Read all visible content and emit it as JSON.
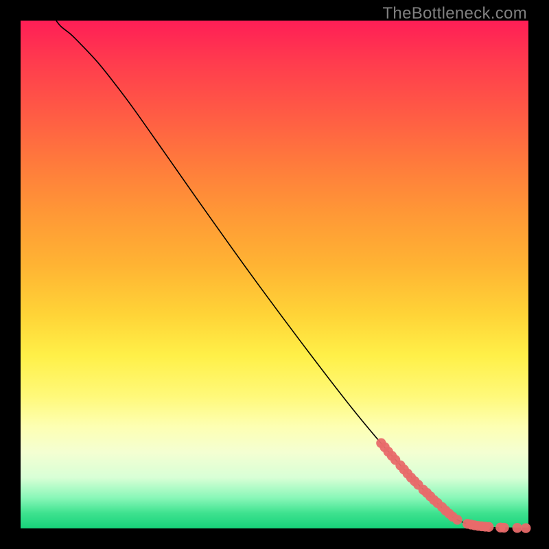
{
  "attribution": "TheBottleneck.com",
  "chart_data": {
    "type": "line",
    "title": "",
    "xlabel": "",
    "ylabel": "",
    "xlim": [
      0,
      100
    ],
    "ylim": [
      0,
      100
    ],
    "curve": {
      "name": "bottleneck-curve",
      "points": [
        {
          "x": 7.0,
          "y": 100.0
        },
        {
          "x": 8.0,
          "y": 98.8
        },
        {
          "x": 10.0,
          "y": 97.2
        },
        {
          "x": 12.0,
          "y": 95.2
        },
        {
          "x": 15.0,
          "y": 92.0
        },
        {
          "x": 18.0,
          "y": 88.3
        },
        {
          "x": 22.0,
          "y": 83.0
        },
        {
          "x": 28.0,
          "y": 74.5
        },
        {
          "x": 35.0,
          "y": 64.5
        },
        {
          "x": 45.0,
          "y": 50.5
        },
        {
          "x": 55.0,
          "y": 37.0
        },
        {
          "x": 65.0,
          "y": 24.0
        },
        {
          "x": 72.0,
          "y": 15.6
        },
        {
          "x": 78.0,
          "y": 9.0
        },
        {
          "x": 82.0,
          "y": 5.0
        },
        {
          "x": 85.0,
          "y": 2.3
        },
        {
          "x": 88.0,
          "y": 0.9
        },
        {
          "x": 92.0,
          "y": 0.25
        },
        {
          "x": 96.0,
          "y": 0.1
        },
        {
          "x": 100.0,
          "y": 0.05
        }
      ]
    },
    "markers": {
      "name": "highlighted-points",
      "color": "#e86a6a",
      "points": [
        {
          "x": 71.0,
          "y": 16.8
        },
        {
          "x": 71.7,
          "y": 16.0
        },
        {
          "x": 72.4,
          "y": 15.1
        },
        {
          "x": 73.1,
          "y": 14.3
        },
        {
          "x": 73.8,
          "y": 13.5
        },
        {
          "x": 74.8,
          "y": 12.4
        },
        {
          "x": 75.5,
          "y": 11.6
        },
        {
          "x": 76.2,
          "y": 10.8
        },
        {
          "x": 76.9,
          "y": 10.0
        },
        {
          "x": 77.6,
          "y": 9.3
        },
        {
          "x": 78.3,
          "y": 8.6
        },
        {
          "x": 79.3,
          "y": 7.6
        },
        {
          "x": 80.0,
          "y": 7.0
        },
        {
          "x": 80.7,
          "y": 6.3
        },
        {
          "x": 81.4,
          "y": 5.6
        },
        {
          "x": 82.1,
          "y": 5.0
        },
        {
          "x": 83.0,
          "y": 4.2
        },
        {
          "x": 83.7,
          "y": 3.5
        },
        {
          "x": 84.4,
          "y": 2.9
        },
        {
          "x": 85.1,
          "y": 2.3
        },
        {
          "x": 86.0,
          "y": 1.7
        },
        {
          "x": 88.0,
          "y": 0.9
        },
        {
          "x": 88.7,
          "y": 0.75
        },
        {
          "x": 89.4,
          "y": 0.62
        },
        {
          "x": 90.1,
          "y": 0.5
        },
        {
          "x": 90.8,
          "y": 0.42
        },
        {
          "x": 91.5,
          "y": 0.35
        },
        {
          "x": 92.2,
          "y": 0.3
        },
        {
          "x": 94.5,
          "y": 0.18
        },
        {
          "x": 95.2,
          "y": 0.15
        },
        {
          "x": 97.8,
          "y": 0.1
        },
        {
          "x": 99.5,
          "y": 0.06
        }
      ]
    }
  }
}
